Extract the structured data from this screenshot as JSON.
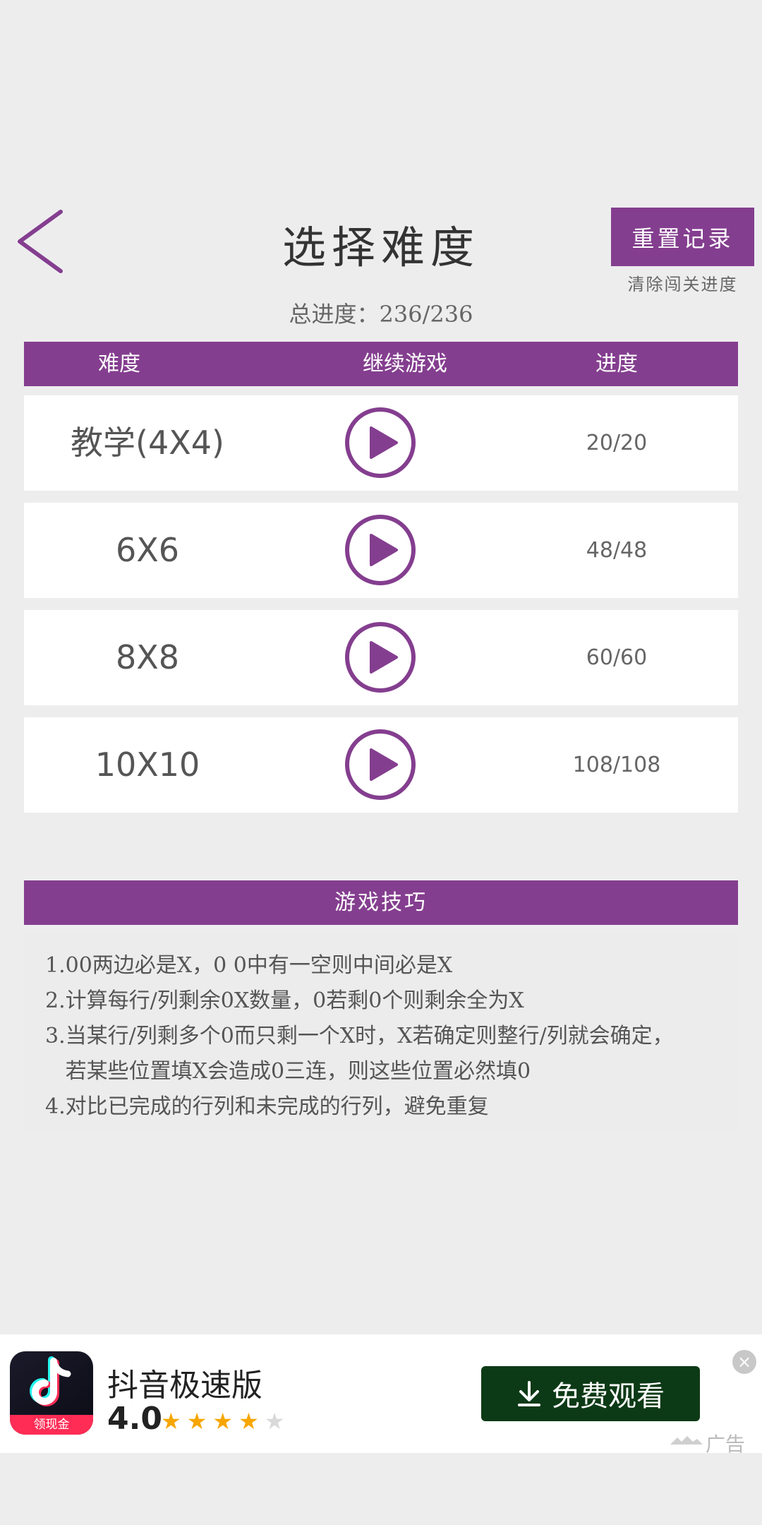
{
  "header": {
    "title": "选择难度",
    "reset_button": "重置记录",
    "reset_subtitle": "清除闯关进度",
    "total_progress": "总进度：236/236"
  },
  "table": {
    "headers": [
      "难度",
      "继续游戏",
      "进度"
    ],
    "rows": [
      {
        "level": "教学(4X4)",
        "progress": "20/20"
      },
      {
        "level": "6X6",
        "progress": "48/48"
      },
      {
        "level": "8X8",
        "progress": "60/60"
      },
      {
        "level": "10X10",
        "progress": "108/108"
      }
    ]
  },
  "tips": {
    "heading": "游戏技巧",
    "lines": [
      "1.00两边必是X，0 0中有一空则中间必是X",
      "2.计算每行/列剩余0X数量，0若剩0个则剩余全为X",
      "3.当某行/列剩多个0而只剩一个X时，X若确定则整行/列就会确定，",
      "   若某些位置填X会造成0三连，则这些位置必然填0",
      "4.对比已完成的行列和未完成的行列，避免重复"
    ]
  },
  "ad": {
    "app_name": "抖音极速版",
    "rating": "4.0",
    "rating_value": 4,
    "rating_max": 5,
    "logo_badge": "领现金",
    "cta": "免费观看",
    "cta_icon": "download-icon",
    "close": "×",
    "label": "广告"
  },
  "colors": {
    "accent": "#843e8f",
    "background": "#ededee",
    "cta_bg": "#0d3a16",
    "star": "#f7a600"
  }
}
